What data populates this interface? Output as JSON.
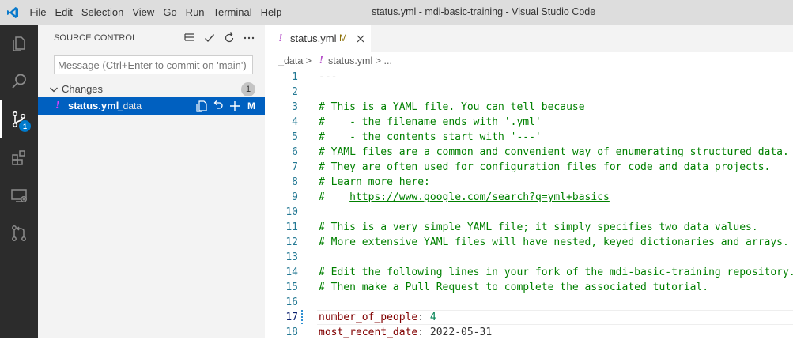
{
  "titlebar": {
    "window_title": "status.yml - mdi-basic-training - Visual Studio Code",
    "menu": [
      {
        "u": "F",
        "rest": "ile"
      },
      {
        "u": "E",
        "rest": "dit"
      },
      {
        "u": "S",
        "rest": "election"
      },
      {
        "u": "V",
        "rest": "iew"
      },
      {
        "u": "G",
        "rest": "o"
      },
      {
        "u": "R",
        "rest": "un"
      },
      {
        "u": "T",
        "rest": "erminal"
      },
      {
        "u": "H",
        "rest": "elp"
      }
    ]
  },
  "activitybar": {
    "items": [
      "explorer-icon",
      "search-icon",
      "source-control-icon",
      "extensions-icon",
      "remote-explorer-icon",
      "pull-requests-icon"
    ],
    "scm_badge": "1"
  },
  "sidebar": {
    "title": "SOURCE CONTROL",
    "commit_placeholder": "Message (Ctrl+Enter to commit on 'main')",
    "changes_label": "Changes",
    "changes_count": "1",
    "file": {
      "name": "status.yml",
      "dir": "_data",
      "status": "M"
    }
  },
  "editor": {
    "tab": {
      "name": "status.yml",
      "modified": "M"
    },
    "breadcrumb": {
      "folder": "_data",
      "sep": " > ",
      "file": "status.yml",
      "tail": " > ..."
    },
    "lines": [
      {
        "n": "1",
        "t": "---"
      },
      {
        "n": "2",
        "t": ""
      },
      {
        "n": "3",
        "t": "# This is a YAML file. You can tell because"
      },
      {
        "n": "4",
        "t": "#    - the filename ends with '.yml'"
      },
      {
        "n": "5",
        "t": "#    - the contents start with '---'"
      },
      {
        "n": "6",
        "t": "# YAML files are a common and convenient way of enumerating structured data."
      },
      {
        "n": "7",
        "t": "# They are often used for configuration files for code and data projects."
      },
      {
        "n": "8",
        "t": "# Learn more here:"
      },
      {
        "n": "9",
        "t": "#    ",
        "link": "https://www.google.com/search?q=yml+basics"
      },
      {
        "n": "10",
        "t": ""
      },
      {
        "n": "11",
        "t": "# This is a very simple YAML file; it simply specifies two data values."
      },
      {
        "n": "12",
        "t": "# More extensive YAML files will have nested, keyed dictionaries and arrays."
      },
      {
        "n": "13",
        "t": ""
      },
      {
        "n": "14",
        "t": "# Edit the following lines in your fork of the mdi-basic-training repository."
      },
      {
        "n": "15",
        "t": "# Then make a Pull Request to complete the associated tutorial."
      },
      {
        "n": "16",
        "t": ""
      },
      {
        "n": "17",
        "key": "number_of_people",
        "val": "4"
      },
      {
        "n": "18",
        "key": "most_recent_date",
        "val": "2022-05-31"
      }
    ]
  }
}
